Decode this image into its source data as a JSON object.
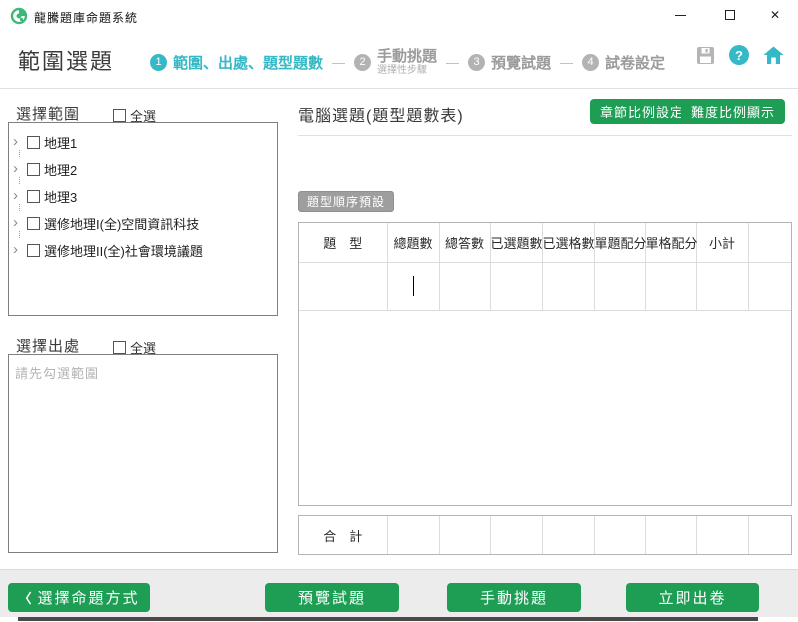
{
  "colors": {
    "green": "#1e9e55",
    "teal": "#35b9c6",
    "badge_gray": "#9e9e9e"
  },
  "icons": {
    "close_glyph": "✕",
    "help_glyph": "?",
    "back_chevron": "〈",
    "tree_chevron": "›"
  },
  "titlebar": {
    "app_title": "龍騰題庫命題系統"
  },
  "header": {
    "page_title": "範圍選題",
    "step_separator": "—",
    "steps": [
      {
        "num": "1",
        "label": "範圍、出處、題型題數",
        "sub": "",
        "active": true
      },
      {
        "num": "2",
        "label": "手動挑題",
        "sub": "選擇性步驟",
        "active": false
      },
      {
        "num": "3",
        "label": "預覽試題",
        "sub": "",
        "active": false
      },
      {
        "num": "4",
        "label": "試卷設定",
        "sub": "",
        "active": false
      }
    ]
  },
  "left": {
    "range": {
      "title": "選擇範圍",
      "select_all": "全選",
      "items": [
        "地理1",
        "地理2",
        "地理3",
        "選修地理I(全)空間資訊科技",
        "選修地理II(全)社會環境議題"
      ]
    },
    "source": {
      "title": "選擇出處",
      "select_all": "全選",
      "placeholder": "請先勾選範圍"
    }
  },
  "right": {
    "title": "電腦選題(題型題數表)",
    "chapter_ratio_button": "章節比例設定",
    "difficulty_ratio_button": "難度比例顯示",
    "order_preset_button": "題型順序預設",
    "table": {
      "headers": [
        "題　型",
        "總題數",
        "總答數",
        "已選題數",
        "已選格數",
        "單題配分",
        "單格配分",
        "小計",
        ""
      ],
      "total_label": "合　計"
    }
  },
  "footer": {
    "back_label": "選擇命題方式",
    "preview_label": "預覽試題",
    "manual_label": "手動挑題",
    "generate_label": "立即出卷"
  }
}
